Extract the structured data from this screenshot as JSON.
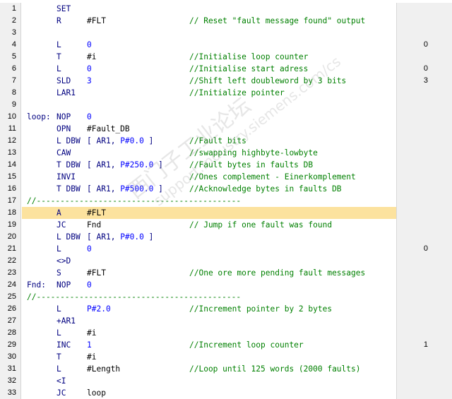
{
  "editor": {
    "lines": [
      {
        "n": "1",
        "label": "",
        "op": "SET",
        "operand": "",
        "operand_kind": "",
        "comment": "",
        "status": ""
      },
      {
        "n": "2",
        "label": "",
        "op": "R",
        "operand": "#FLT",
        "operand_kind": "sym",
        "comment": "// Reset \"fault message found\" output",
        "status": ""
      },
      {
        "n": "3",
        "label": "",
        "op": "",
        "operand": "",
        "operand_kind": "",
        "comment": "",
        "status": ""
      },
      {
        "n": "4",
        "label": "",
        "op": "L",
        "operand": "0",
        "operand_kind": "num",
        "comment": "",
        "status": "0"
      },
      {
        "n": "5",
        "label": "",
        "op": "T",
        "operand": "#i",
        "operand_kind": "sym",
        "comment": "//Initialise loop counter",
        "status": ""
      },
      {
        "n": "6",
        "label": "",
        "op": "L",
        "operand": "0",
        "operand_kind": "num",
        "comment": "//Initialise start adress",
        "status": "0"
      },
      {
        "n": "7",
        "label": "",
        "op": "SLD",
        "operand": "3",
        "operand_kind": "num",
        "comment": "//Shift left doubleword by 3 bits",
        "status": "3"
      },
      {
        "n": "8",
        "label": "",
        "op": "LAR1",
        "operand": "",
        "operand_kind": "",
        "comment": "//Initialize pointer",
        "status": ""
      },
      {
        "n": "9",
        "label": "",
        "op": "",
        "operand": "",
        "operand_kind": "",
        "comment": "",
        "status": ""
      },
      {
        "n": "10",
        "label": "loop:",
        "op": "NOP",
        "operand": "0",
        "operand_kind": "num",
        "comment": "",
        "status": ""
      },
      {
        "n": "11",
        "label": "",
        "op": "OPN",
        "operand": "#Fault_DB",
        "operand_kind": "sym",
        "comment": "",
        "status": ""
      },
      {
        "n": "12",
        "label": "",
        "op": "L DBW",
        "operand": "",
        "operand_kind": "addr",
        "addr_reg": "AR1",
        "addr_ptr": "P#0.0",
        "comment": "//Fault bits",
        "status": ""
      },
      {
        "n": "13",
        "label": "",
        "op": "CAW",
        "operand": "",
        "operand_kind": "",
        "comment": "//swapping highbyte-lowbyte",
        "status": ""
      },
      {
        "n": "14",
        "label": "",
        "op": "T DBW",
        "operand": "",
        "operand_kind": "addr",
        "addr_reg": "AR1",
        "addr_ptr": "P#250.0",
        "comment": "//Fault bytes in faults DB",
        "status": ""
      },
      {
        "n": "15",
        "label": "",
        "op": "INVI",
        "operand": "",
        "operand_kind": "",
        "comment": "//Ones complement - Einerkomplement",
        "status": ""
      },
      {
        "n": "16",
        "label": "",
        "op": "T DBW",
        "operand": "",
        "operand_kind": "addr",
        "addr_reg": "AR1",
        "addr_ptr": "P#500.0",
        "comment": "//Acknowledge bytes in faults DB",
        "status": ""
      },
      {
        "n": "17",
        "label": "",
        "op": "",
        "operand": "",
        "operand_kind": "",
        "separator": "//-------------------------------------------",
        "comment": "",
        "status": ""
      },
      {
        "n": "18",
        "label": "",
        "op": "A",
        "operand": "#FLT",
        "operand_kind": "sym",
        "comment": "",
        "status": "",
        "highlight": true
      },
      {
        "n": "19",
        "label": "",
        "op": "JC",
        "operand": "Fnd",
        "operand_kind": "sym",
        "comment": "// Jump if one fault was found",
        "status": ""
      },
      {
        "n": "20",
        "label": "",
        "op": "L DBW",
        "operand": "",
        "operand_kind": "addr",
        "addr_reg": "AR1",
        "addr_ptr": "P#0.0",
        "comment": "",
        "status": ""
      },
      {
        "n": "21",
        "label": "",
        "op": "L",
        "operand": "0",
        "operand_kind": "num",
        "comment": "",
        "status": "0"
      },
      {
        "n": "22",
        "label": "",
        "op": "<>D",
        "operand": "",
        "operand_kind": "",
        "comment": "",
        "status": ""
      },
      {
        "n": "23",
        "label": "",
        "op": "S",
        "operand": "#FLT",
        "operand_kind": "sym",
        "comment": "//One ore more pending fault messages",
        "status": ""
      },
      {
        "n": "24",
        "label": "Fnd:",
        "op": "NOP",
        "operand": "0",
        "operand_kind": "num",
        "comment": "",
        "status": ""
      },
      {
        "n": "25",
        "label": "",
        "op": "",
        "operand": "",
        "operand_kind": "",
        "separator": "//-------------------------------------------",
        "comment": "",
        "status": ""
      },
      {
        "n": "26",
        "label": "",
        "op": "L",
        "operand": "P#2.0",
        "operand_kind": "num",
        "comment": "//Increment pointer by 2 bytes",
        "status": ""
      },
      {
        "n": "27",
        "label": "",
        "op": "+AR1",
        "operand": "",
        "operand_kind": "",
        "comment": "",
        "status": ""
      },
      {
        "n": "28",
        "label": "",
        "op": "L",
        "operand": "#i",
        "operand_kind": "sym",
        "comment": "",
        "status": ""
      },
      {
        "n": "29",
        "label": "",
        "op": "INC",
        "operand": "1",
        "operand_kind": "num",
        "comment": "//Increment loop counter",
        "status": "1"
      },
      {
        "n": "30",
        "label": "",
        "op": "T",
        "operand": "#i",
        "operand_kind": "sym",
        "comment": "",
        "status": ""
      },
      {
        "n": "31",
        "label": "",
        "op": "L",
        "operand": "#Length",
        "operand_kind": "sym",
        "comment": "//Loop until 125 words (2000 faults)",
        "status": ""
      },
      {
        "n": "32",
        "label": "",
        "op": "<I",
        "operand": "",
        "operand_kind": "",
        "comment": "",
        "status": ""
      },
      {
        "n": "33",
        "label": "",
        "op": "JC",
        "operand": "loop",
        "operand_kind": "sym",
        "comment": "",
        "status": ""
      }
    ]
  },
  "watermark": {
    "line1": "西门子工业论坛",
    "line2": "support.industry.siemens.com/cs"
  },
  "colors": {
    "highlight": "#fce29e",
    "keyword": "#000080",
    "number": "#0000ff",
    "comment": "#008000",
    "gutter": "#f0f0f0"
  }
}
